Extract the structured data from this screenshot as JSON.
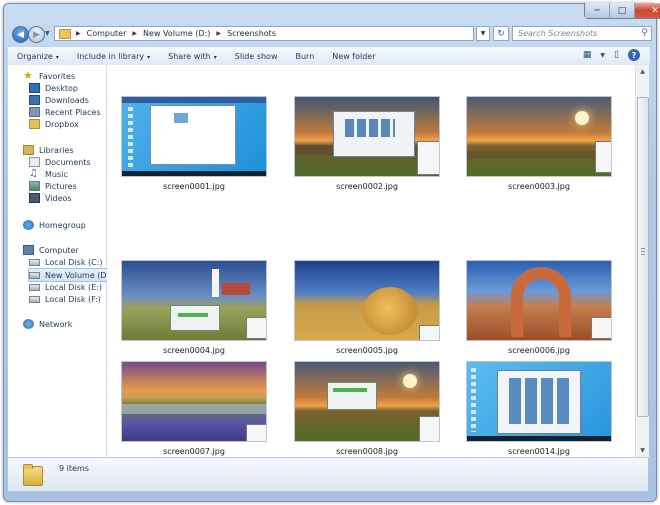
{
  "window": {
    "controls": {
      "minimize": "─",
      "maximize": "□",
      "close": "✕"
    }
  },
  "address": {
    "crumbs": [
      "Computer",
      "New Volume (D:)",
      "Screenshots"
    ],
    "separator": "▶",
    "search_placeholder": "Search Screenshots"
  },
  "toolbar": {
    "organize": "Organize",
    "include_in_library": "Include in library",
    "share_with": "Share with",
    "slide_show": "Slide show",
    "burn": "Burn",
    "new_folder": "New folder",
    "dropdown_glyph": "▾"
  },
  "nav": {
    "favorites": "Favorites",
    "desktop": "Desktop",
    "downloads": "Downloads",
    "recent_places": "Recent Places",
    "dropbox": "Dropbox",
    "libraries": "Libraries",
    "documents": "Documents",
    "music": "Music",
    "pictures": "Pictures",
    "videos": "Videos",
    "homegroup": "Homegroup",
    "computer": "Computer",
    "local_c": "Local Disk (C:)",
    "new_volume_d": "New Volume (D:)",
    "local_e": "Local Disk (E:)",
    "local_f": "Local Disk (F:)",
    "network": "Network"
  },
  "files": [
    {
      "name": "screen0001.jpg",
      "theme": "desktop-blue"
    },
    {
      "name": "screen0002.jpg",
      "theme": "sunset-fence-window"
    },
    {
      "name": "screen0003.jpg",
      "theme": "sunset-fence"
    },
    {
      "name": "screen0004.jpg",
      "theme": "lighthouse"
    },
    {
      "name": "screen0005.jpg",
      "theme": "hay-bale"
    },
    {
      "name": "screen0006.jpg",
      "theme": "arch"
    },
    {
      "name": "screen0007.jpg",
      "theme": "lake-flowers"
    },
    {
      "name": "screen0008.jpg",
      "theme": "sunset-dialog"
    },
    {
      "name": "screen0014.jpg",
      "theme": "desktop-blue-window"
    }
  ],
  "status": {
    "count": "9 items"
  },
  "colors": {
    "accent": "#2f67b6",
    "selection": "#cfe3f8"
  }
}
